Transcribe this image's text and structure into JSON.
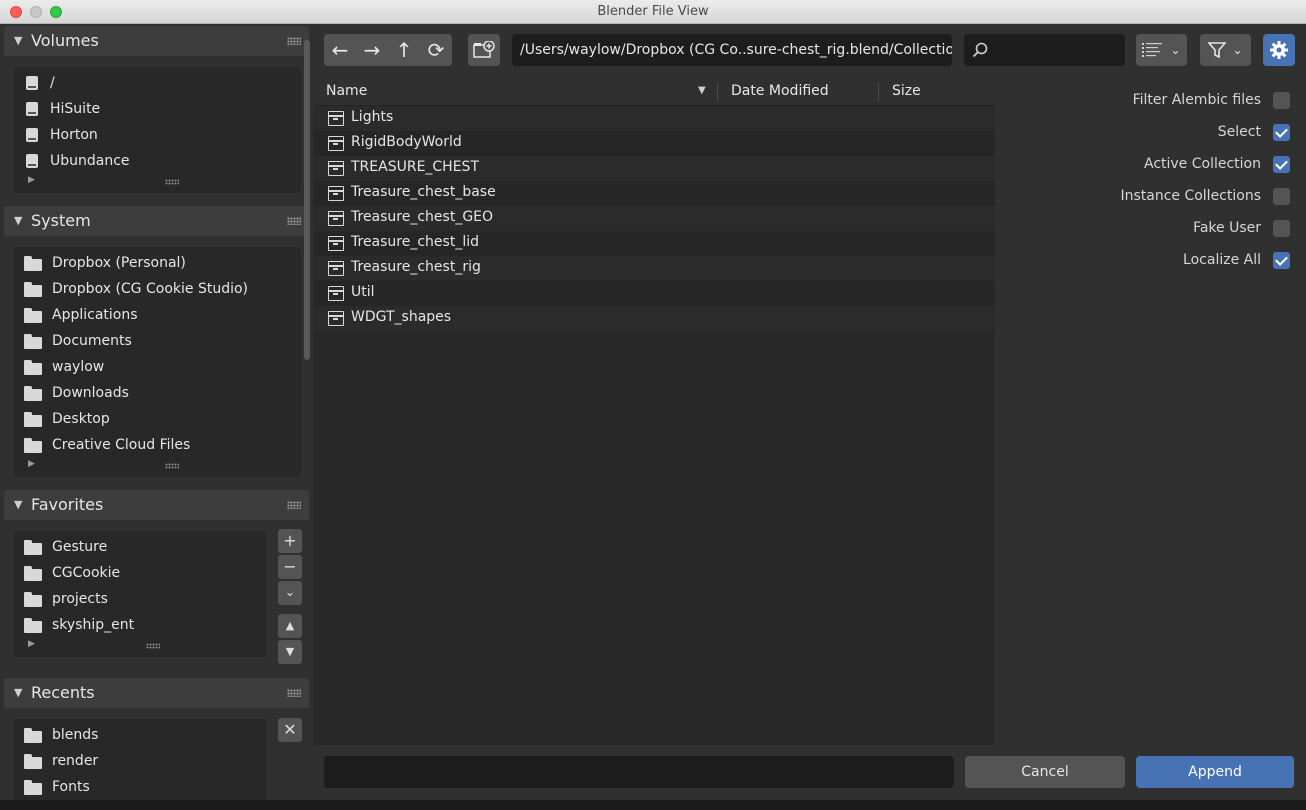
{
  "window": {
    "title": "Blender File View"
  },
  "sidebar": {
    "volumes": {
      "title": "Volumes",
      "items": [
        "/",
        "HiSuite",
        "Horton",
        "Ubundance"
      ]
    },
    "system": {
      "title": "System",
      "items": [
        "Dropbox (Personal)",
        "Dropbox (CG Cookie Studio)",
        "Applications",
        "Documents",
        "waylow",
        "Downloads",
        "Desktop",
        "Creative Cloud Files"
      ]
    },
    "favorites": {
      "title": "Favorites",
      "items": [
        "Gesture",
        "CGCookie",
        "projects",
        "skyship_ent"
      ]
    },
    "recents": {
      "title": "Recents",
      "items": [
        "blends",
        "render",
        "Fonts"
      ]
    }
  },
  "toolbar": {
    "path": "/Users/waylow/Dropbox (CG Co..sure-chest_rig.blend/Collection/",
    "search_value": ""
  },
  "filelist": {
    "columns": {
      "name": "Name",
      "date": "Date Modified",
      "size": "Size"
    },
    "rows": [
      "Lights",
      "RigidBodyWorld",
      "TREASURE_CHEST",
      "Treasure_chest_base",
      "Treasure_chest_GEO",
      "Treasure_chest_lid",
      "Treasure_chest_rig",
      "Util",
      "WDGT_shapes"
    ]
  },
  "options": [
    {
      "label": "Filter Alembic files",
      "checked": false
    },
    {
      "label": "Select",
      "checked": true
    },
    {
      "label": "Active Collection",
      "checked": true
    },
    {
      "label": "Instance Collections",
      "checked": false
    },
    {
      "label": "Fake User",
      "checked": false
    },
    {
      "label": "Localize All",
      "checked": true
    }
  ],
  "bottom": {
    "filename_value": "",
    "cancel_label": "Cancel",
    "append_label": "Append"
  },
  "colors": {
    "accent": "#4772b3",
    "panel": "#303030",
    "field": "#1d1d1d",
    "button": "#545454"
  }
}
